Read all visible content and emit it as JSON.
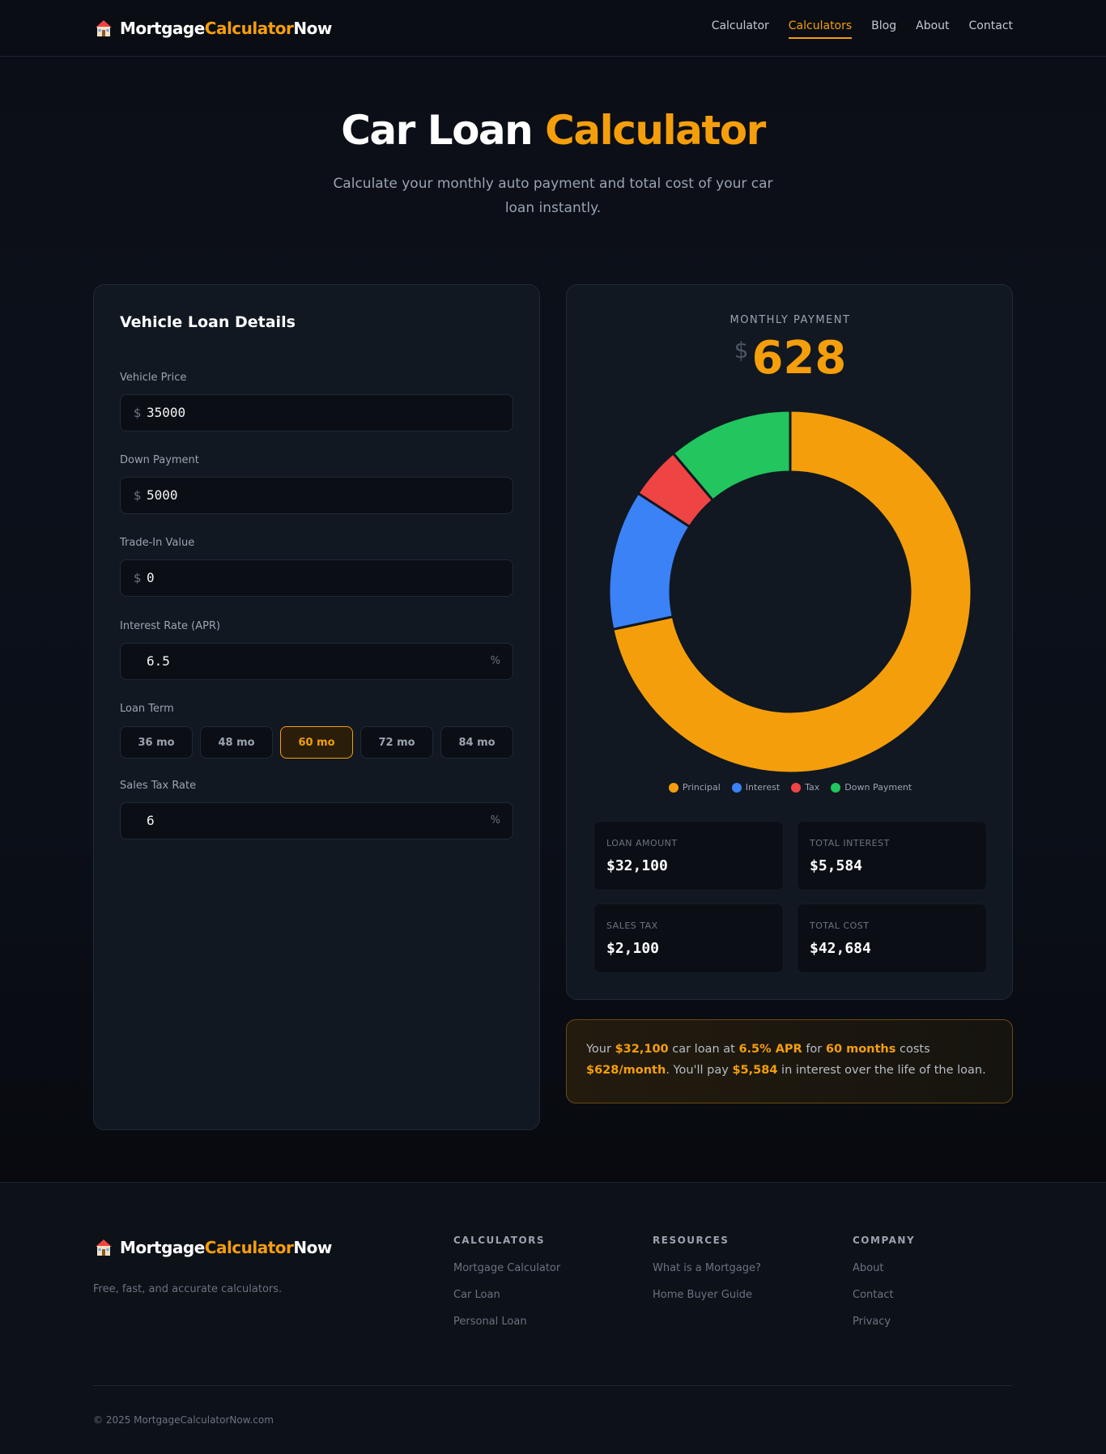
{
  "header": {
    "logo": {
      "part1": "Mortgage",
      "part2": "Calculator",
      "part3": "Now",
      "icon": "house-icon"
    },
    "nav": [
      "Calculator",
      "Calculators",
      "Blog",
      "About",
      "Contact"
    ],
    "active_nav": "Calculators"
  },
  "hero": {
    "title_white": "Car Loan",
    "title_orange": "Calculator",
    "subtitle": "Calculate your monthly auto payment and total cost of your car loan instantly."
  },
  "form": {
    "title": "Vehicle Loan Details",
    "vehicle_price": {
      "label": "Vehicle Price",
      "prefix": "$",
      "value": "35000"
    },
    "down_payment": {
      "label": "Down Payment",
      "prefix": "$",
      "value": "5000"
    },
    "trade_in": {
      "label": "Trade-In Value",
      "prefix": "$",
      "value": "0"
    },
    "interest_rate": {
      "label": "Interest Rate (APR)",
      "suffix": "%",
      "value": "6.5"
    },
    "loan_term": {
      "label": "Loan Term",
      "options": [
        "36 mo",
        "48 mo",
        "60 mo",
        "72 mo",
        "84 mo"
      ],
      "selected": "60 mo"
    },
    "sales_tax": {
      "label": "Sales Tax Rate",
      "suffix": "%",
      "value": "6"
    }
  },
  "result": {
    "monthly_label": "MONTHLY PAYMENT",
    "currency": "$",
    "monthly_value": "628",
    "stats": [
      {
        "label": "LOAN AMOUNT",
        "value": "$32,100"
      },
      {
        "label": "TOTAL INTEREST",
        "value": "$5,584"
      },
      {
        "label": "SALES TAX",
        "value": "$2,100"
      },
      {
        "label": "TOTAL COST",
        "value": "$42,684"
      }
    ]
  },
  "chart_data": {
    "type": "pie",
    "donut": true,
    "categories": [
      "Principal",
      "Interest",
      "Tax",
      "Down Payment"
    ],
    "values": [
      32100,
      5584,
      2100,
      5000
    ],
    "colors": [
      "#f59e0b",
      "#3b82f6",
      "#ef4444",
      "#22c55e"
    ],
    "legend_position": "bottom"
  },
  "summary": {
    "t1": "Your ",
    "loan": "$32,100",
    "t2": " car loan at ",
    "apr": "6.5% APR",
    "t3": " for ",
    "months": "60 months",
    "t4": " costs ",
    "monthly": "$628/month",
    "t5": ". You'll pay ",
    "interest": "$5,584",
    "t6": " in interest over the life of the loan."
  },
  "footer": {
    "tagline": "Free, fast, and accurate calculators.",
    "columns": [
      {
        "title": "CALCULATORS",
        "links": [
          "Mortgage Calculator",
          "Car Loan",
          "Personal Loan"
        ]
      },
      {
        "title": "RESOURCES",
        "links": [
          "What is a Mortgage?",
          "Home Buyer Guide"
        ]
      },
      {
        "title": "COMPANY",
        "links": [
          "About",
          "Contact",
          "Privacy"
        ]
      }
    ],
    "copyright": "© 2025 MortgageCalculatorNow.com"
  }
}
